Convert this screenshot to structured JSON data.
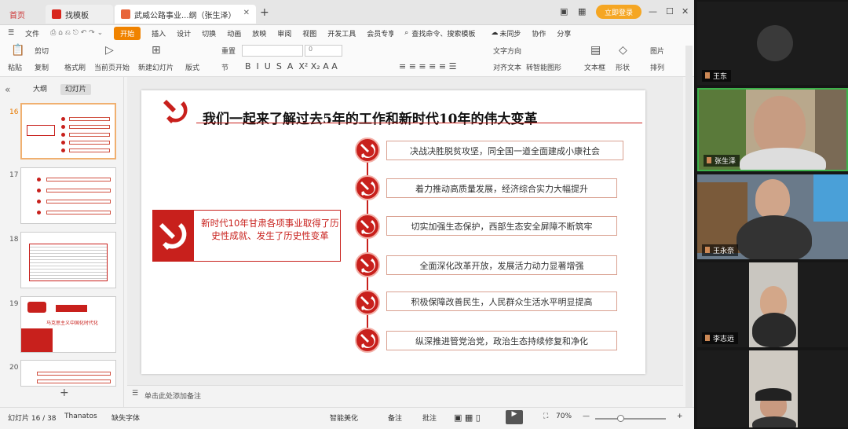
{
  "tabs": {
    "home": "首页",
    "template": "找模板",
    "document": "武威公路事业...纲（张生泽）"
  },
  "window": {
    "login": "立即登录"
  },
  "menu": {
    "file": "文件",
    "items": [
      "开始",
      "插入",
      "设计",
      "切换",
      "动画",
      "放映",
      "审阅",
      "视图",
      "开发工具",
      "会员专享"
    ],
    "search": "查找命令、搜索模板",
    "unsynced": "未同步",
    "collab": "协作",
    "share": "分享"
  },
  "ribbon": {
    "paste": "粘贴",
    "cut": "剪切",
    "copy": "复制",
    "format_painter": "格式刷",
    "play_from_current": "当前页开始",
    "new_slide": "新建幻灯片",
    "layout": "版式",
    "section": "节",
    "reset": "重置",
    "font_size": "0",
    "text_direction": "文字方向",
    "align_text": "对齐文本",
    "convert_smartart": "转智能图形",
    "textbox": "文本框",
    "shapes": "形状",
    "picture": "图片",
    "fill": "填充",
    "arrange": "排列"
  },
  "left_panel": {
    "tab_outline": "大纲",
    "tab_slides": "幻灯片",
    "slide_numbers": [
      "16",
      "17",
      "18",
      "19",
      "20"
    ],
    "thumb19_title": "马克思主义中国化时代化"
  },
  "slide": {
    "title": "我们一起来了解过去5年的工作和新时代10年的伟大变革",
    "left_card": "新时代10年甘肃各项事业取得了历史性成就、发生了历史性变革",
    "items": [
      "决战决胜脱贫攻坚，同全国一道全面建成小康社会",
      "着力推动高质量发展，经济综合实力大幅提升",
      "切实加强生态保护，西部生态安全屏障不断筑牢",
      "全面深化改革开放，发展活力动力显著增强",
      "积极保障改善民生，人民群众生活水平明显提高",
      "纵深推进管党治党，政治生态持续修复和净化"
    ]
  },
  "notes": {
    "placeholder": "单击此处添加备注"
  },
  "status": {
    "slide_info": "幻灯片 16 / 38",
    "theme": "Thanatos",
    "missing_font": "缺失字体",
    "smart_beautify": "智能美化",
    "notes": "备注",
    "comments": "批注",
    "zoom": "70%"
  },
  "participants": [
    {
      "name": "王东"
    },
    {
      "name": "张生泽"
    },
    {
      "name": "王永奈"
    },
    {
      "name": "李志远"
    },
    {
      "name": ""
    }
  ],
  "colors": {
    "accent": "#f08300",
    "party_red": "#c8201c"
  }
}
